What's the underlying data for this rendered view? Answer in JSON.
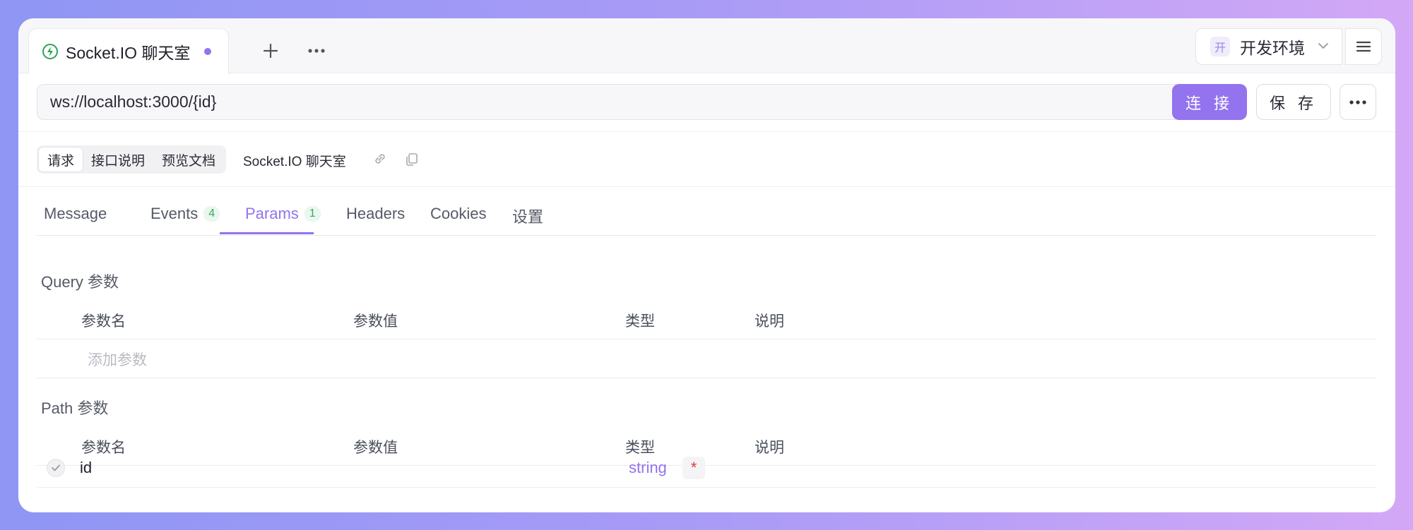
{
  "colors": {
    "accent": "#9373ee",
    "success": "#3aa85a",
    "danger": "#e03a3a"
  },
  "tab": {
    "title": "Socket.IO 聊天室",
    "icon": "socket-io-icon"
  },
  "env": {
    "badge": "开",
    "name": "开发环境"
  },
  "url": {
    "value": "ws://localhost:3000/{id}"
  },
  "buttons": {
    "connect": "连 接",
    "save": "保 存"
  },
  "segment": {
    "items": [
      "请求",
      "接口说明",
      "预览文档"
    ],
    "selected": "请求"
  },
  "doc_name": "Socket.IO 聊天室",
  "tabs": {
    "message": "Message",
    "events": "Events",
    "events_count": "4",
    "params": "Params",
    "params_count": "1",
    "headers": "Headers",
    "cookies": "Cookies",
    "settings": "设置",
    "active": "Params"
  },
  "query": {
    "title": "Query 参数",
    "headers": [
      "参数名",
      "参数值",
      "类型",
      "说明"
    ],
    "placeholder": "添加参数"
  },
  "path": {
    "title": "Path 参数",
    "headers": [
      "参数名",
      "参数值",
      "类型",
      "说明"
    ],
    "rows": [
      {
        "name": "id",
        "value": "",
        "type": "string",
        "required": "*"
      }
    ]
  }
}
